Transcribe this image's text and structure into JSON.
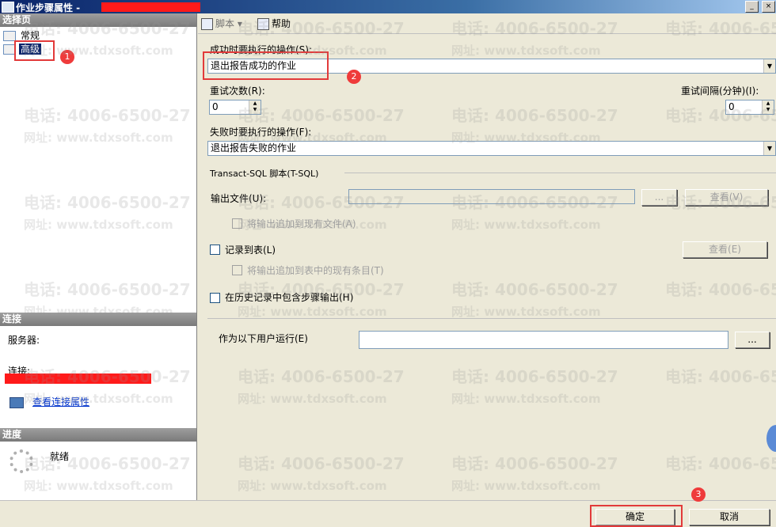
{
  "window": {
    "title": "作业步骤属性 -",
    "minimize_glyph": "_",
    "close_glyph": "×"
  },
  "left": {
    "select_page_header": "选择页",
    "nav_items": [
      {
        "label": "常规",
        "icon": "page-icon",
        "selected": false
      },
      {
        "label": "高级",
        "icon": "page-icon",
        "selected": true
      }
    ],
    "connection_header": "连接",
    "server_label": "服务器:",
    "connection_label": "连接:",
    "view_connection_link": "查看连接属性",
    "progress_header": "进度",
    "progress_status": "就绪"
  },
  "toolbar": {
    "script_label": "脚本",
    "dropdown_glyph": "▾",
    "help_label": "帮助"
  },
  "form": {
    "on_success_label": "成功时要执行的操作(S):",
    "on_success_value": "退出报告成功的作业",
    "retry_attempts_label": "重试次数(R):",
    "retry_attempts_value": "0",
    "retry_interval_label": "重试间隔(分钟)(I):",
    "retry_interval_value": "0",
    "on_failure_label": "失败时要执行的操作(F):",
    "on_failure_value": "退出报告失败的作业",
    "tsql_group_label": "Transact-SQL 脚本(T-SQL)",
    "output_file_label": "输出文件(U):",
    "output_file_value": "",
    "browse_label": "...",
    "view_label": "查看(V)",
    "append_file_label": "将输出追加到现有文件(A)",
    "log_table_label": "记录到表(L)",
    "view_table_label": "查看(E)",
    "append_table_label": "将输出追加到表中的现有条目(T)",
    "history_label": "在历史记录中包含步骤输出(H)",
    "run_as_label": "作为以下用户运行(E)",
    "run_as_value": "",
    "run_as_browse_label": "..."
  },
  "buttons": {
    "ok_label": "确定",
    "cancel_label": "取消"
  },
  "annotations": [
    "1",
    "2",
    "3"
  ],
  "watermark": {
    "phone": "电话: 4006-6500-27",
    "site": "网址: www.tdxsoft.com"
  },
  "colors": {
    "annotation_red": "#e23a3a",
    "title_blue": "#0a246a",
    "redaction": "#ff1a1a",
    "link": "#0033cc"
  }
}
